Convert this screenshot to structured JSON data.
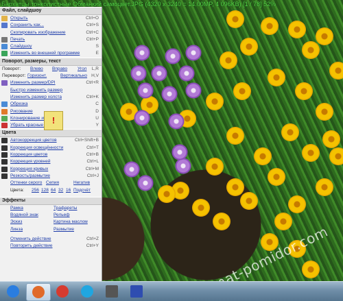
{
  "window": {
    "title": "Бархатцы тонколистные Обманкий самоцвет.JPG (4320 x 3240 = 14.00MP, 4 096KB) [1 / 78] 52%"
  },
  "menu": {
    "sections": [
      {
        "title": "Файл, слайдшоу",
        "items": [
          {
            "label": "Открыть",
            "shortcut": "Ctrl+O",
            "icon": "open-folder-icon",
            "color": "#e2b34a"
          },
          {
            "label": "Сохранить как...",
            "shortcut": "Ctrl+S",
            "icon": "save-icon",
            "color": "#5577cc"
          },
          {
            "label": "Скопировать изображение",
            "shortcut": "Ctrl+C",
            "icon": "",
            "color": ""
          },
          {
            "label": "Печать",
            "shortcut": "Ctrl+P",
            "icon": "print-icon",
            "color": "#777777"
          },
          {
            "label": "Слайдшоу",
            "shortcut": "S",
            "icon": "slideshow-icon",
            "color": "#4a8bd6"
          },
          {
            "label": "Изменить во внешней программе",
            "shortcut": "E",
            "icon": "external-edit-icon",
            "color": "#3aa55a"
          }
        ]
      }
    ],
    "rotate_section": {
      "title": "Поворот, размеры, текст",
      "rotate": {
        "label": "Поворот:",
        "left": "Влево",
        "right": "Вправо",
        "angle": "Угол",
        "shortcut": "L,R"
      },
      "flip": {
        "label": "Переворот:",
        "horizontal": "Горизонт.",
        "vertical": "Вертикально",
        "shortcut": "H,V"
      },
      "items": [
        {
          "label": "Изменить размер/DPI",
          "shortcut": "Ctrl+R",
          "icon": "resize-icon",
          "color": "#7f5fc0"
        },
        {
          "label": "Быстро изменить размер",
          "shortcut": "",
          "icon": "",
          "color": ""
        },
        {
          "label": "Изменить размер холста",
          "shortcut": "Ctrl+K",
          "icon": "",
          "color": ""
        },
        {
          "label": "Обрезка",
          "shortcut": "C",
          "icon": "crop-icon",
          "color": "#4a8bd6"
        },
        {
          "label": "Рисование",
          "shortcut": "D",
          "icon": "paint-icon",
          "color": "#e07a2a"
        },
        {
          "label": "Клонирование и ретушь",
          "shortcut": "U",
          "icon": "clone-icon",
          "color": "#55aa55"
        },
        {
          "label": "Убрать красные глаза",
          "shortcut": "Y",
          "icon": "red-eye-icon",
          "color": "#cc3333"
        }
      ]
    },
    "colors_section": {
      "title": "Цвета",
      "items": [
        {
          "label": "Автокоррекция цветов",
          "shortcut": "Ctrl+Shift+B",
          "icon": "auto-color-icon",
          "color": "#333333"
        },
        {
          "label": "Коррекция освещённости",
          "shortcut": "Ctrl+T",
          "icon": "lighting-icon",
          "color": "#333333"
        },
        {
          "label": "Коррекция цветов",
          "shortcut": "Ctrl+B",
          "icon": "color-balance-icon",
          "color": "#333333"
        },
        {
          "label": "Коррекция уровней",
          "shortcut": "Ctrl+L",
          "icon": "levels-icon",
          "color": "#333333"
        },
        {
          "label": "Коррекция кривых",
          "shortcut": "Ctrl+M",
          "icon": "curves-icon",
          "color": "#333333"
        },
        {
          "label": "Резкость/размытие",
          "shortcut": "Ctrl+J",
          "icon": "sharpen-icon",
          "color": "#333333"
        }
      ],
      "tones": {
        "gray": "Оттенки серого",
        "sepia": "Сепия",
        "negative": "Негатив"
      },
      "palette": {
        "label": "Цвета:",
        "values": [
          "256",
          "128",
          "64",
          "32",
          "16"
        ],
        "more": "Подсчёт"
      }
    },
    "effects_section": {
      "title": "Эффекты",
      "rows": [
        [
          "Рамка",
          "Трафареты"
        ],
        [
          "Водяной знак",
          "Рельеф"
        ],
        [
          "Эскиз",
          "Картина маслом"
        ],
        [
          "Линза",
          "Размытие"
        ]
      ],
      "undo": {
        "label": "Отменить действие",
        "shortcut": "Ctrl+Z"
      },
      "redo": {
        "label": "Повторить действие",
        "shortcut": "Ctrl+Y"
      }
    }
  },
  "warning_badge": "!",
  "watermark": "tomat-pomidor.com",
  "taskbar": {
    "items": [
      {
        "name": "start-orb-icon",
        "color": "#2a7de0"
      },
      {
        "name": "image-viewer-eye-icon",
        "color": "#e06a2a"
      },
      {
        "name": "chrome-icon",
        "color": "#d63b2f"
      },
      {
        "name": "skype-icon",
        "color": "#20a6e0"
      },
      {
        "name": "scanner-icon",
        "color": "#555555"
      },
      {
        "name": "floppy-save-icon",
        "color": "#2f4db0"
      }
    ]
  }
}
